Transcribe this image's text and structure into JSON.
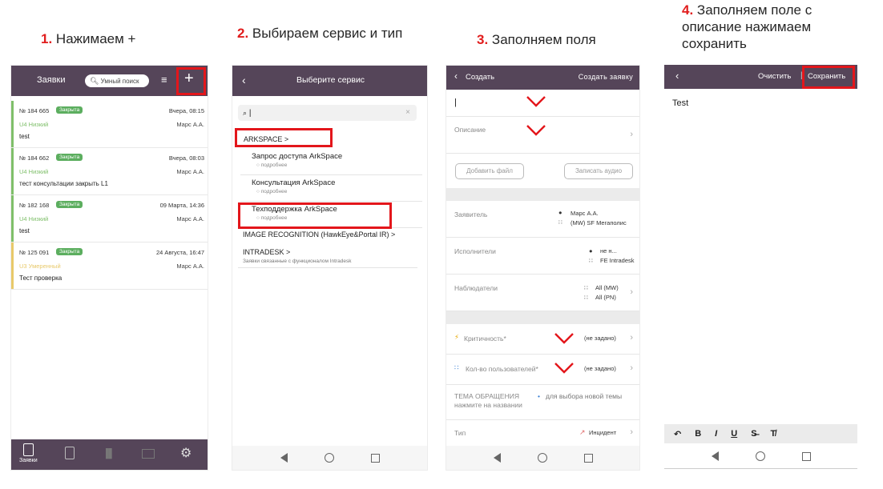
{
  "steps": [
    {
      "num": "1.",
      "text": "Нажимаем +"
    },
    {
      "num": "2.",
      "text": "Выбираем сервис и тип"
    },
    {
      "num": "3.",
      "text": "Заполняем поля"
    },
    {
      "num": "4.",
      "text": "Заполняем поле с описание нажимаем сохранить"
    }
  ],
  "screen1": {
    "title": "Заявки",
    "search_label": "Умный поиск",
    "add_label": "+",
    "tickets": [
      {
        "no": "№ 184 665",
        "badge": "Закрыта",
        "date": "Вчера, 08:15",
        "prio": "U4 Низкий",
        "author": "Марс А.А.",
        "desc": "test",
        "bar": "#7fbf6a"
      },
      {
        "no": "№ 184 662",
        "badge": "Закрыта",
        "date": "Вчера, 08:03",
        "prio": "U4 Низкий",
        "author": "Марс А.А.",
        "desc": "тест консультации закрыть L1",
        "bar": "#7fbf6a"
      },
      {
        "no": "№ 182 168",
        "badge": "Закрыта",
        "date": "09 Марта, 14:36",
        "prio": "U4 Низкий",
        "author": "Марс А.А.",
        "desc": "test",
        "bar": "#7fbf6a"
      },
      {
        "no": "№ 125 091",
        "badge": "Закрыта",
        "date": "24 Августа, 16:47",
        "prio": "U3 Умеренный",
        "author": "Марс А.А.",
        "desc": "Тест проверка",
        "bar": "#e8c96a"
      }
    ],
    "tabbar_label": "Заявки"
  },
  "screen2": {
    "title": "Выберите сервис",
    "search_value": "|",
    "group1": "ARKSPACE >",
    "items": [
      {
        "title": "Запрос доступа ArkSpace",
        "sub": "подробнее"
      },
      {
        "title": "Консультация ArkSpace",
        "sub": "подробнее"
      },
      {
        "title": "Техподдержка ArkSpace",
        "sub": "подробнее"
      }
    ],
    "group2": "IMAGE RECOGNITION (HawkEye&Portal IR) >",
    "group3": "INTRADESK >",
    "group3_sub": "Заявки связанные с функционалом Intradesk"
  },
  "screen3": {
    "back_label": "Создать",
    "create_label": "Создать заявку",
    "name_value": "|",
    "desc_label": "Описание",
    "add_file": "Добавить файл",
    "record_audio": "Записать аудио",
    "applicant_label": "Заявитель",
    "applicant_name": "Марс А.А.",
    "applicant_org": "(MW) SF Мегаполис",
    "executors_label": "Исполнители",
    "executor_name": "не н...",
    "executor_group": "FE Intradesk",
    "observers_label": "Наблюдатели",
    "observer_1": "All (MW)",
    "observer_2": "All (PN)",
    "criticality_label": "Критичность*",
    "criticality_value": "(не задано)",
    "users_label": "Кол-во пользователей*",
    "users_value": "(не задано)",
    "topic_label": "ТЕМА ОБРАЩЕНИЯ нажмите на названии",
    "topic_hint": "для выбора новой темы",
    "type_label": "Тип",
    "type_value": "Инцидент"
  },
  "screen4": {
    "clear_label": "Очистить",
    "save_label": "Сохранить",
    "body_text": "Test",
    "toolbar": [
      "↶",
      "B",
      "I",
      "U",
      "S̶",
      "T̸"
    ]
  },
  "colors": {
    "appbar": "#554559",
    "highlight": "#e3161b",
    "badge": "#5cae5f"
  }
}
